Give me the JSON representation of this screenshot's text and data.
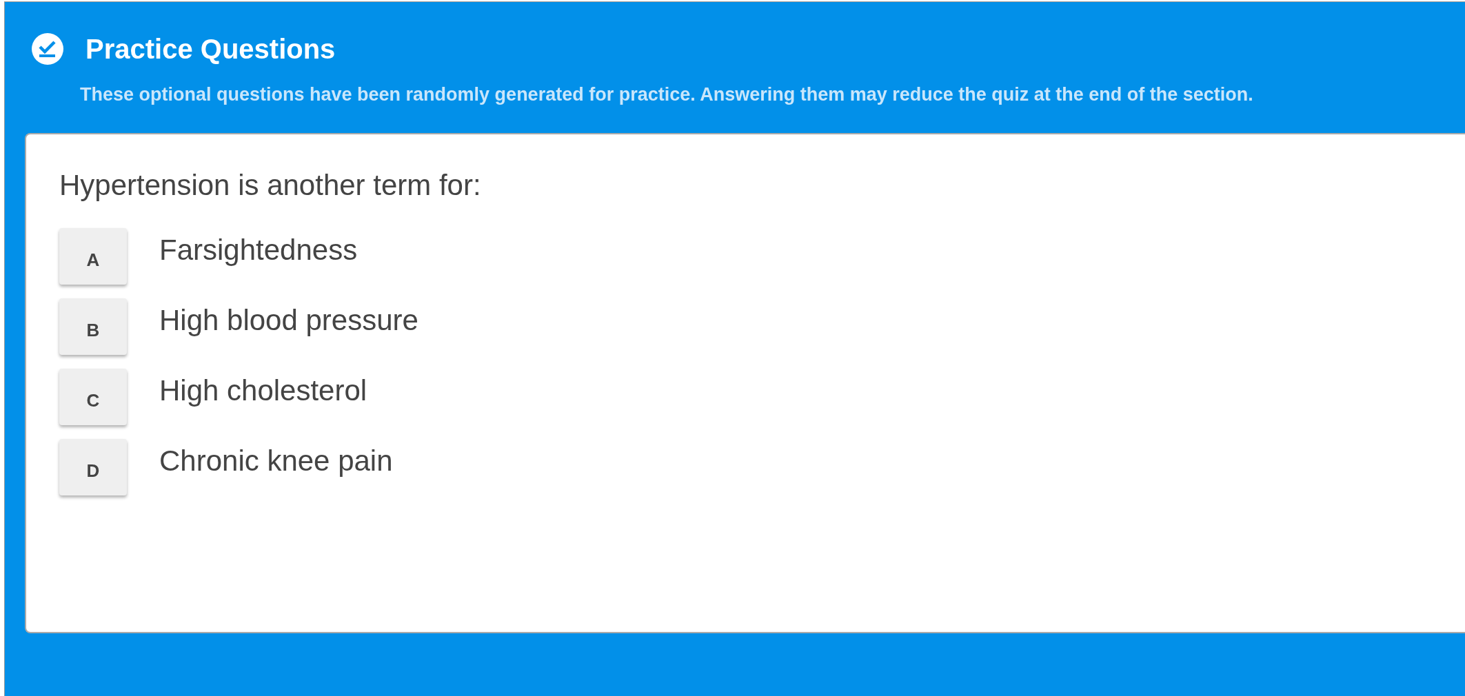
{
  "header": {
    "title": "Practice Questions",
    "description": "These optional questions have been randomly generated for practice. Answering them may reduce the quiz at the end of the section."
  },
  "question": {
    "prompt": "Hypertension is another term for:",
    "options": [
      {
        "letter": "A",
        "text": "Farsightedness"
      },
      {
        "letter": "B",
        "text": "High blood pressure"
      },
      {
        "letter": "C",
        "text": "High cholesterol"
      },
      {
        "letter": "D",
        "text": "Chronic knee pain"
      }
    ]
  }
}
